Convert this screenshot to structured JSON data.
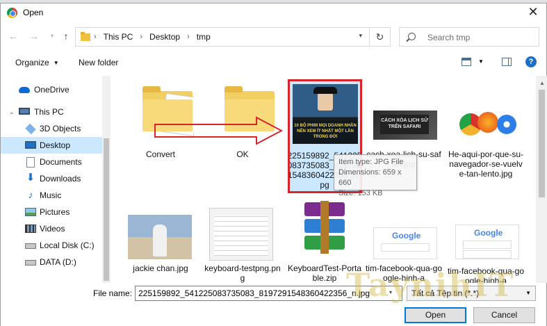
{
  "window": {
    "title": "Open"
  },
  "address_bar": {
    "crumbs": [
      "This PC",
      "Desktop",
      "tmp"
    ]
  },
  "search": {
    "placeholder": "Search tmp"
  },
  "toolbar": {
    "organize_label": "Organize",
    "new_folder_label": "New folder",
    "help_label": "?"
  },
  "sidebar": {
    "items": [
      {
        "label": "OneDrive",
        "icon": "cloud-icon"
      },
      {
        "label": "This PC",
        "icon": "computer-icon"
      },
      {
        "label": "3D Objects",
        "icon": "cube-icon"
      },
      {
        "label": "Desktop",
        "icon": "desktop-icon",
        "selected": true
      },
      {
        "label": "Documents",
        "icon": "document-icon"
      },
      {
        "label": "Downloads",
        "icon": "download-icon"
      },
      {
        "label": "Music",
        "icon": "music-icon"
      },
      {
        "label": "Pictures",
        "icon": "picture-icon"
      },
      {
        "label": "Videos",
        "icon": "video-icon"
      },
      {
        "label": "Local Disk (C:)",
        "icon": "disk-icon"
      },
      {
        "label": "DATA (D:)",
        "icon": "disk-icon"
      }
    ]
  },
  "files": [
    {
      "name": "Convert",
      "kind": "folder"
    },
    {
      "name": "OK",
      "kind": "folder"
    },
    {
      "name": "225159892_541225083735083_8197291548360422356_n.jpg",
      "kind": "image",
      "selected": true,
      "thumb_text": "10 BỘ PHIM MỌI DOANH NHÂN NÊN XEM ÍT NHẤT MỘT LẦN TRONG ĐỜI"
    },
    {
      "name": "cach-xoa-lich-su-safari.jpg",
      "kind": "image",
      "thumb_text": "CÁCH XÓA LỊCH SỬ TRÊN SAFARI"
    },
    {
      "name": "He-aqui-por-que-su-navegador-se-vuelve-tan-lento.jpg",
      "kind": "image"
    },
    {
      "name": "jackie chan.jpg",
      "kind": "image"
    },
    {
      "name": "keyboard-testpng.png",
      "kind": "image"
    },
    {
      "name": "KeyboardTest-Portable.zip",
      "kind": "archive"
    },
    {
      "name": "tim-facebook-qua-google-hinh-a",
      "kind": "image",
      "thumb_text": "Google"
    },
    {
      "name": "tim-facebook-qua-google-hinh-a",
      "kind": "image",
      "thumb_text": "Google"
    }
  ],
  "tooltip": {
    "lines": [
      "Item type: JPG File",
      "Dimensions: 659 x 660",
      "Size: 153 KB"
    ]
  },
  "file_name": {
    "label": "File name:",
    "value": "225159892_541225083735083_8197291548360422356_n.jpg"
  },
  "file_type": {
    "value": "Tất cả Tệp tin (*.*)"
  },
  "buttons": {
    "open": "Open",
    "cancel": "Cancel"
  },
  "watermark": "TaynihIT"
}
